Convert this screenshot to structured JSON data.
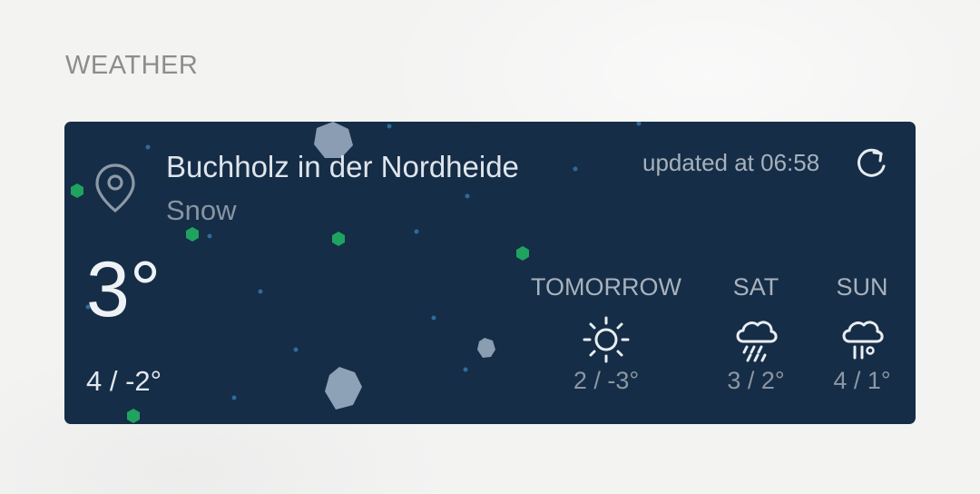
{
  "section": {
    "title": "WEATHER"
  },
  "current": {
    "location": "Buchholz in der Nordheide",
    "condition": "Snow",
    "updated": "updated at 06:58",
    "temperature": "3°",
    "range": "4 / -2°"
  },
  "forecast": [
    {
      "day": "TOMORROW",
      "icon": "sun-icon",
      "range": "2 / -3°"
    },
    {
      "day": "SAT",
      "icon": "rain-cloud-icon",
      "range": "3 / 2°"
    },
    {
      "day": "SUN",
      "icon": "drizzle-cloud-icon",
      "range": "4 / 1°"
    }
  ],
  "colors": {
    "card_background": "#152d46",
    "particle_green": "#1fa35f",
    "particle_grey": "#9aabbd"
  }
}
